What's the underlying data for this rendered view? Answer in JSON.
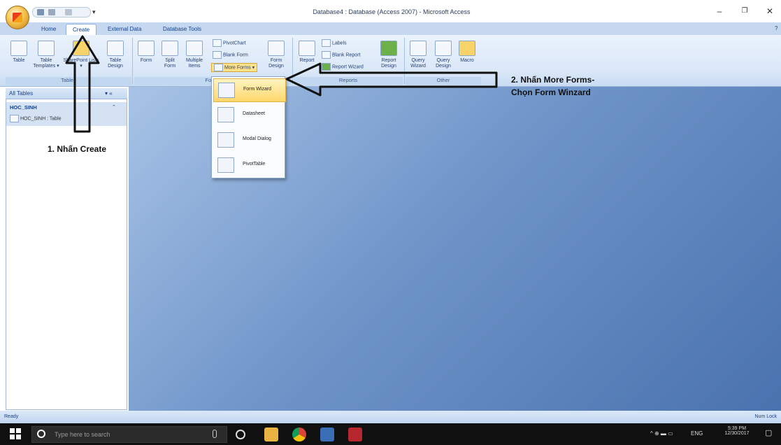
{
  "window": {
    "title": "Database4 : Database (Access 2007) - Microsoft Access",
    "controls": {
      "minimize": "–",
      "restore": "❐",
      "close": "✕"
    }
  },
  "tabs": [
    {
      "label": "Home",
      "active": false
    },
    {
      "label": "Create",
      "active": true
    },
    {
      "label": "External Data",
      "active": false
    },
    {
      "label": "Database Tools",
      "active": false
    }
  ],
  "ribbon": {
    "tables": {
      "label": "Tables",
      "buttons": [
        "Table",
        "Table Templates ▾",
        "SharePoint Lists ▾",
        "Table Design"
      ]
    },
    "forms": {
      "label": "Forms",
      "buttons": [
        "Form",
        "Split Form",
        "Multiple Items"
      ],
      "small": [
        "PivotChart",
        "Blank Form",
        "More Forms ▾"
      ],
      "design": "Form Design"
    },
    "reports": {
      "label": "Reports",
      "buttons": [
        "Report"
      ],
      "small": [
        "Labels",
        "Blank Report",
        "Report Wizard"
      ],
      "design": "Report Design"
    },
    "other": {
      "label": "Other",
      "buttons": [
        "Query Wizard",
        "Query Design",
        "Macro"
      ]
    }
  },
  "more_forms_menu": {
    "items": [
      {
        "label": "Form Wizard",
        "highlighted": true
      },
      {
        "label": "Datasheet",
        "highlighted": false
      },
      {
        "label": "Modal Dialog",
        "highlighted": false
      },
      {
        "label": "PivotTable",
        "highlighted": false
      }
    ]
  },
  "nav_pane": {
    "header": "All Tables",
    "group": "HOC_SINH",
    "item": "HOC_SINH : Table"
  },
  "status_bar": {
    "left": "Ready",
    "right": "Num Lock"
  },
  "taskbar": {
    "search_placeholder": "Type here to search",
    "language": "ENG",
    "time": "5:39 PM",
    "date": "12/30/2017"
  },
  "annotations": {
    "step1": "1. Nhấn Create",
    "step2_line1": "2. Nhấn More Forms-",
    "step2_line2": "Chọn Form Winzard"
  },
  "colors": {
    "accent": "#15428b",
    "workspace": "#6f95c9",
    "highlight": "#ffd66b"
  }
}
